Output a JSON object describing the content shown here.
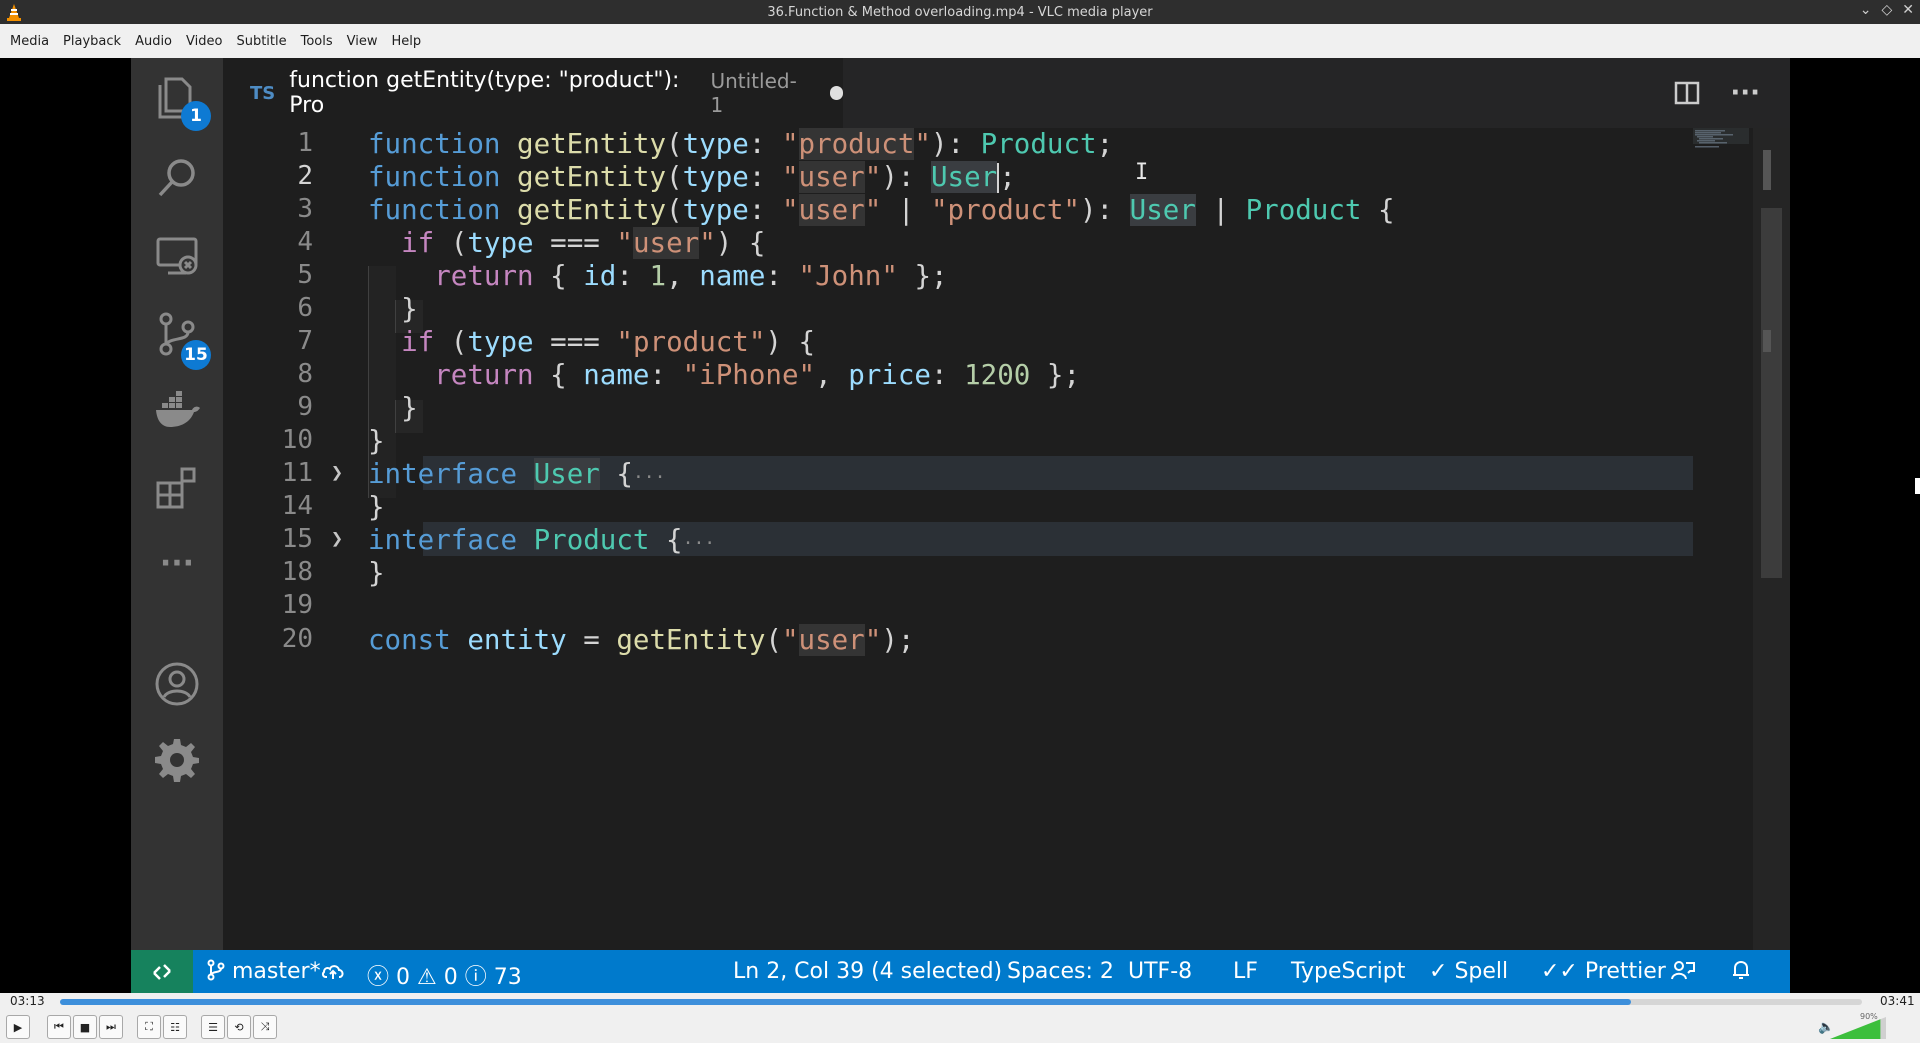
{
  "window": {
    "title": "36.Function & Method overloading.mp4 - VLC media player",
    "buttons": [
      "⌄",
      "◇",
      "✕"
    ]
  },
  "menu": [
    "Media",
    "Playback",
    "Audio",
    "Video",
    "Subtitle",
    "Tools",
    "View",
    "Help"
  ],
  "vscode": {
    "activity_icons": [
      "files-icon",
      "search-icon",
      "remote-explorer-icon",
      "source-control-icon",
      "docker-icon",
      "extensions-icon",
      "more-icon",
      "account-icon",
      "settings-gear-icon"
    ],
    "badges": {
      "explorer": "1",
      "source_control": "15"
    },
    "more_label": "···",
    "tab": {
      "lang": "TS",
      "name": "function getEntity(type: \"product\"): Pro",
      "description": "Untitled-1"
    },
    "tab_actions": {
      "split": "split-editor-icon",
      "more": "···"
    },
    "line_numbers": [
      "1",
      "2",
      "3",
      "4",
      "5",
      "6",
      "7",
      "8",
      "9",
      "10",
      "11",
      "14",
      "15",
      "18",
      "19",
      "20"
    ],
    "current_line": "2",
    "status": {
      "branch": "master*",
      "errors": "0",
      "warnings": "0",
      "info": "73",
      "position": "Ln 2, Col 39 (4 selected)",
      "spaces": "Spaces: 2",
      "encoding": "UTF-8",
      "eol": "LF",
      "language": "TypeScript",
      "spell": "Spell",
      "prettier": "Prettier"
    }
  },
  "player": {
    "elapsed": "03:13",
    "total": "03:41",
    "progress": 0.872,
    "volume_label": "90%",
    "volume": 0.9
  }
}
